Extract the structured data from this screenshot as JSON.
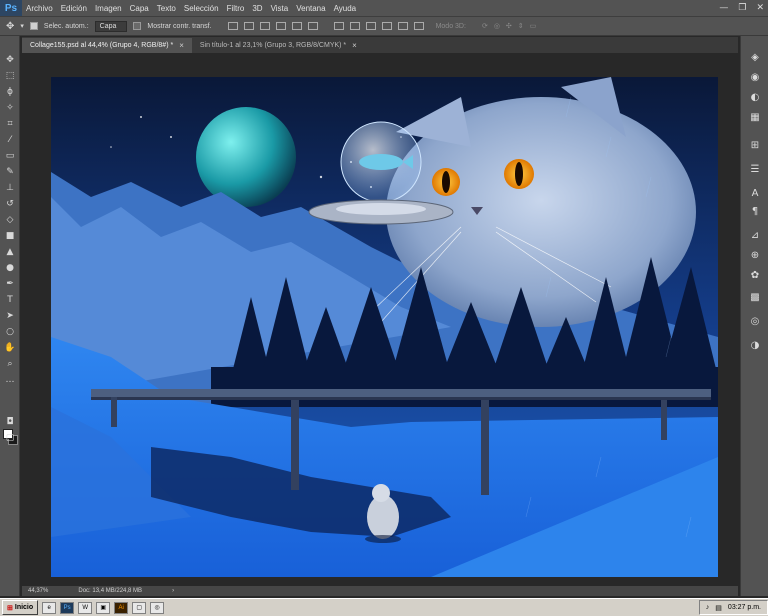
{
  "app": {
    "logo": "Ps"
  },
  "menu": [
    "Archivo",
    "Edición",
    "Imagen",
    "Capa",
    "Texto",
    "Selección",
    "Filtro",
    "3D",
    "Vista",
    "Ventana",
    "Ayuda"
  ],
  "window_controls": {
    "minimize": "—",
    "restore": "❐",
    "close": "✕"
  },
  "options": {
    "auto_select_label": "Selec. autom.:",
    "auto_select_value": "Capa",
    "show_transform_label": "Mostrar contr. transf.",
    "mode_3d_label": "Modo 3D:"
  },
  "tabs": [
    {
      "label": "Collage155.psd al 44,4% (Grupo 4, RGB/8#) *",
      "close": "×"
    },
    {
      "label": "Sin título-1 al 23,1% (Grupo 3, RGB/8/CMYK) *",
      "close": "×"
    }
  ],
  "status": {
    "zoom": "44,37%",
    "doc": "Doc: 13,4 MB/224,8 MB",
    "arrow": "›"
  },
  "taskbar": {
    "start_label": "Inicio",
    "apps": [
      "e",
      "Ps",
      "W",
      "▣",
      "Ai",
      "▢",
      "◎"
    ],
    "clock": "03:27 p.m."
  },
  "colors": {
    "accent": "#2d8cf0",
    "sky": "#0b1f4a",
    "snow": "#1e7ae8"
  }
}
